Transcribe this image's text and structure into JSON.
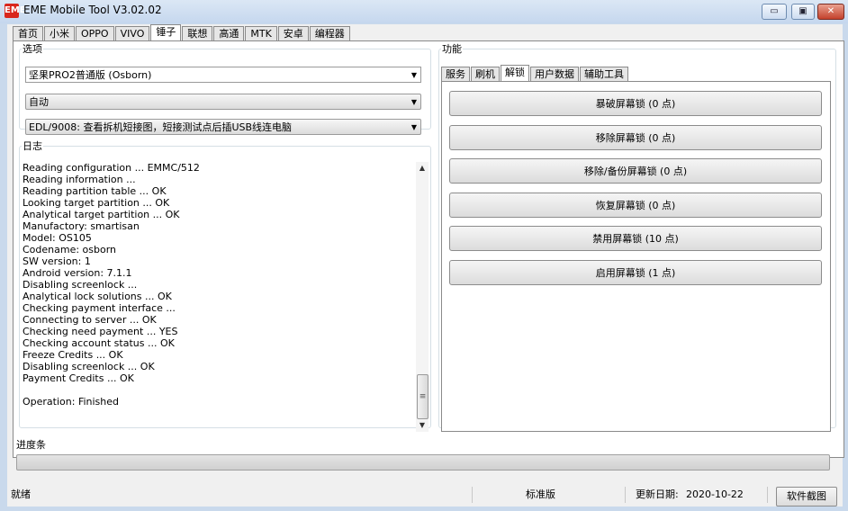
{
  "window": {
    "title": "EME Mobile Tool V3.02.02",
    "icon": "EME",
    "buttons": {
      "minimize": "▭",
      "restore": "▣",
      "close": "✕"
    }
  },
  "main_tabs": [
    "首页",
    "小米",
    "OPPO",
    "VIVO",
    "锤子",
    "联想",
    "高通",
    "MTK",
    "安卓",
    "编程器"
  ],
  "active_main_tab": "锤子",
  "options": {
    "legend": "选项",
    "model": "坚果PRO2普通版 (Osborn)",
    "mode": "自动",
    "edl": "EDL/9008: 查看拆机短接图，短接测试点后插USB线连电脑"
  },
  "log": {
    "legend": "日志",
    "lines": [
      "Reading configuration ... EMMC/512",
      "Reading information ...",
      "Reading partition table ... OK",
      "Looking target partition ... OK",
      "Analytical target partition ... OK",
      "Manufactory: smartisan",
      "Model: OS105",
      "Codename: osborn",
      "SW version: 1",
      "Android version: 7.1.1",
      "Disabling screenlock ...",
      "Analytical lock solutions ... OK",
      "Checking payment interface ...",
      "Connecting to server ... OK",
      "Checking need payment ... YES",
      "Checking account status ... OK",
      "Freeze Credits ... OK",
      "Disabling screenlock ... OK",
      "Payment Credits ... OK",
      "",
      "Operation: Finished"
    ]
  },
  "functions": {
    "legend": "功能",
    "tabs": [
      "服务",
      "刷机",
      "解锁",
      "用户数据",
      "辅助工具"
    ],
    "active_tab": "解锁",
    "buttons": [
      "暴破屏幕锁 (0 点)",
      "移除屏幕锁 (0 点)",
      "移除/备份屏幕锁 (0 点)",
      "恢复屏幕锁 (0 点)",
      "禁用屏幕锁 (10 点)",
      "启用屏幕锁 (1 点)"
    ]
  },
  "progress": {
    "label": "进度条",
    "value": 0,
    "color": "#3cb54a"
  },
  "status": {
    "state": "就绪",
    "edition": "标准版",
    "update_label": "更新日期:",
    "update_date": "2020-10-22",
    "screenshot_button": "软件截图"
  }
}
